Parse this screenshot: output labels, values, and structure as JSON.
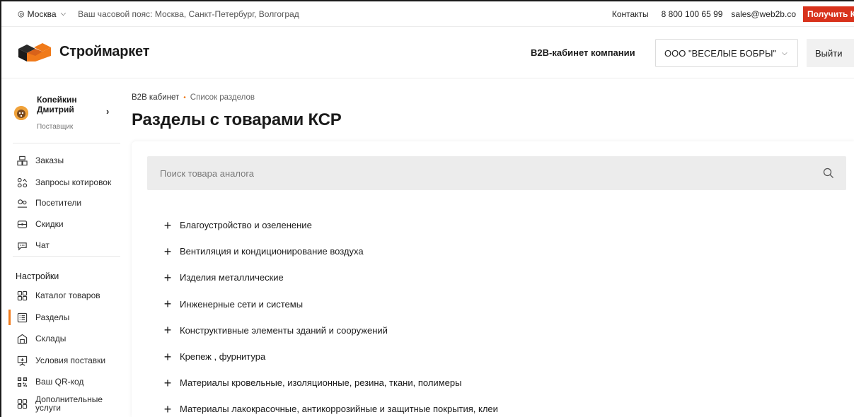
{
  "topbar": {
    "city": "Москва",
    "timezone": "Ваш часовой пояс: Москва, Санкт-Петербург, Волгоград",
    "contacts": "Контакты",
    "phone": "8 800 100 65 99",
    "email": "sales@web2b.co",
    "cta": "Получить КП"
  },
  "header": {
    "logo_text": "Строймаркет",
    "cabinet_label": "B2B-кабинет компании",
    "company": "ООО \"ВЕСЕЛЫЕ БОБРЫ\"",
    "logout": "Выйти"
  },
  "profile": {
    "name": "Копейкин Дмитрий",
    "role": "Поставщик"
  },
  "sidebar": {
    "main_items": [
      {
        "label": "Заказы",
        "icon": "orders-icon"
      },
      {
        "label": "Запросы котировок",
        "icon": "quotes-icon"
      },
      {
        "label": "Посетители",
        "icon": "visitors-icon"
      },
      {
        "label": "Скидки",
        "icon": "discounts-icon"
      },
      {
        "label": "Чат",
        "icon": "chat-icon"
      }
    ],
    "settings_title": "Настройки",
    "settings_items": [
      {
        "label": "Каталог товаров",
        "icon": "catalog-icon"
      },
      {
        "label": "Разделы",
        "icon": "sections-icon",
        "active": true
      },
      {
        "label": "Склады",
        "icon": "warehouse-icon"
      },
      {
        "label": "Условия поставки",
        "icon": "delivery-icon"
      },
      {
        "label": "Ваш QR-код",
        "icon": "qr-code-icon"
      },
      {
        "label": "Дополнительные услуги",
        "icon": "services-icon"
      }
    ]
  },
  "breadcrumb": {
    "root": "B2B кабинет",
    "current": "Список разделов"
  },
  "page_title": "Разделы с товарами КСР",
  "search": {
    "placeholder": "Поиск товара аналога"
  },
  "sections": [
    "Благоустройство и озеленение",
    "Вентиляция и кондиционирование воздуха",
    "Изделия металлические",
    "Инженерные сети и системы",
    "Конструктивные элементы зданий и сооружений",
    "Крепеж , фурнитура",
    "Материалы кровельные, изоляционные, резина, ткани, полимеры",
    "Материалы лакокрасочные, антикоррозийные и защитные покрытия, клеи"
  ],
  "colors": {
    "accent": "#f07a1a",
    "cta": "#d8321c",
    "search_bg": "#ececec"
  }
}
